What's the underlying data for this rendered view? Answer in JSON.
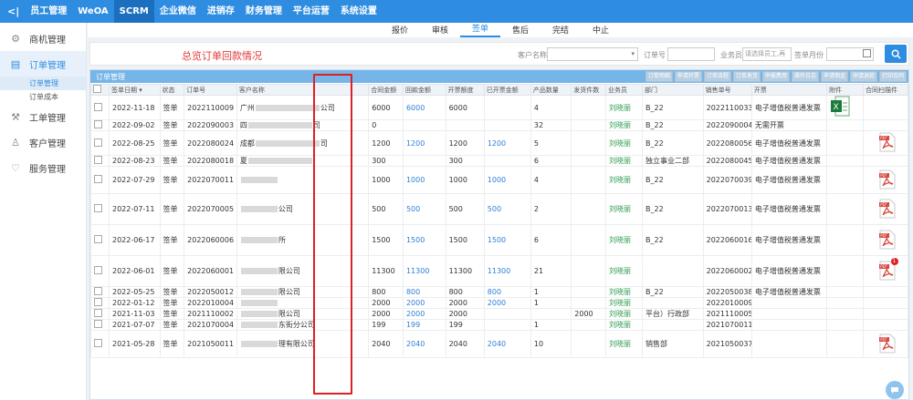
{
  "topbar": {
    "back": "<|",
    "nav": [
      "员工管理",
      "WeOA",
      "SCRM",
      "企业微信",
      "进销存",
      "财务管理",
      "平台运营",
      "系统设置"
    ],
    "active": "SCRM"
  },
  "sidebar": {
    "items": [
      {
        "label": "商机管理",
        "icon": "gear-icon"
      },
      {
        "label": "订单管理",
        "icon": "order-icon",
        "active": true,
        "subs": [
          {
            "label": "订单管理",
            "active": true
          },
          {
            "label": "订单成本",
            "active": false
          }
        ]
      },
      {
        "label": "工单管理",
        "icon": "ticket-icon"
      },
      {
        "label": "客户管理",
        "icon": "user-icon"
      },
      {
        "label": "服务管理",
        "icon": "heart-icon"
      }
    ]
  },
  "tabs": [
    "报价",
    "审核",
    "签单",
    "售后",
    "完结",
    "中止"
  ],
  "tabs_active": "签单",
  "annotation": "总览订单回款情况",
  "filters": {
    "customer_label": "客户名称",
    "order_label": "订单号",
    "staff_label": "业务员",
    "staff_placeholder": "请选择员工,再",
    "month_label": "签单月份"
  },
  "panel": {
    "title": "订单管理",
    "buttons": [
      "订单明细",
      "申请开票",
      "订单流程",
      "订单发货",
      "申报费用",
      "操作日志",
      "申请佣金",
      "申请退款",
      "打印合同"
    ]
  },
  "table": {
    "headers": [
      "",
      "签单日期 ▾",
      "状态",
      "订单号",
      "客户名称",
      "合同金额",
      "回款金额",
      "开票额度",
      "已开票金额",
      "产品数量",
      "发货件数",
      "业务员",
      "部门",
      "销售单号",
      "开票",
      "附件",
      "合同扫描件"
    ],
    "rows": [
      {
        "date": "2022-11-18",
        "status": "签单",
        "order": "2022110009",
        "cust_pre": "广州",
        "cust_post": "公司",
        "contract": "6000",
        "paid": "6000",
        "quota": "6000",
        "invoiced": "",
        "qty": "4",
        "ship": "",
        "sales": "刘晓丽",
        "dept": "B_22",
        "salesno": "2022110033",
        "invoice": "电子增值税普通发票",
        "att": "xls",
        "scan": "",
        "h": 27
      },
      {
        "date": "2022-09-02",
        "status": "签单",
        "order": "2022090003",
        "cust_pre": "四",
        "cust_post": "司",
        "contract": "0",
        "paid": "",
        "quota": "",
        "invoiced": "",
        "qty": "32",
        "ship": "",
        "sales": "刘晓丽",
        "dept": "B_22",
        "salesno": "2022090004",
        "invoice": "无需开票",
        "att": "",
        "scan": "",
        "h": 11
      },
      {
        "date": "2022-08-25",
        "status": "签单",
        "order": "2022080024",
        "cust_pre": "成都",
        "cust_post": "司",
        "contract": "1200",
        "paid": "1200",
        "quota": "1200",
        "invoiced": "1200",
        "qty": "5",
        "ship": "",
        "sales": "刘晓丽",
        "dept": "B_22",
        "salesno": "2022080056",
        "invoice": "电子增值税普通发票",
        "att": "",
        "scan": "pdf",
        "h": 27
      },
      {
        "date": "2022-08-23",
        "status": "签单",
        "order": "2022080018",
        "cust_pre": "夏",
        "cust_post": "",
        "contract": "300",
        "paid": "",
        "quota": "300",
        "invoiced": "",
        "qty": "6",
        "ship": "",
        "sales": "刘晓丽",
        "dept": "独立事业二部",
        "salesno": "2022080045",
        "invoice": "电子增值税普通发票",
        "att": "",
        "scan": "",
        "h": 11
      },
      {
        "date": "2022-07-29",
        "status": "签单",
        "order": "2022070011",
        "cust_pre": "",
        "cust_post": "",
        "contract": "1000",
        "paid": "1000",
        "quota": "1000",
        "invoiced": "1000",
        "qty": "4",
        "ship": "",
        "sales": "刘晓丽",
        "dept": "B_22",
        "salesno": "2022070039",
        "invoice": "电子增值税普通发票",
        "att": "",
        "scan": "pdf",
        "h": 30
      },
      {
        "date": "2022-07-11",
        "status": "签单",
        "order": "2022070005",
        "cust_pre": "",
        "cust_post": "公司",
        "contract": "500",
        "paid": "500",
        "quota": "500",
        "invoiced": "500",
        "qty": "2",
        "ship": "",
        "sales": "刘晓丽",
        "dept": "B_22",
        "salesno": "2022070013",
        "invoice": "电子增值税普通发票",
        "att": "",
        "scan": "pdf",
        "h": 34
      },
      {
        "date": "2022-06-17",
        "status": "签单",
        "order": "2022060006",
        "cust_pre": "",
        "cust_post": "所",
        "contract": "1500",
        "paid": "1500",
        "quota": "1500",
        "invoiced": "1500",
        "qty": "6",
        "ship": "",
        "sales": "刘晓丽",
        "dept": "B_22",
        "salesno": "2022060016",
        "invoice": "电子增值税普通发票",
        "att": "",
        "scan": "pdf",
        "h": 34
      },
      {
        "date": "2022-06-01",
        "status": "签单",
        "order": "2022060001",
        "cust_pre": "",
        "cust_post": "限公司",
        "contract": "11300",
        "paid": "11300",
        "quota": "11300",
        "invoiced": "11300",
        "qty": "21",
        "ship": "",
        "sales": "刘晓丽",
        "dept": "",
        "salesno": "2022060002",
        "invoice": "电子增值税普通发票",
        "att": "",
        "scan": "pdf1",
        "h": 34
      },
      {
        "date": "2022-05-25",
        "status": "签单",
        "order": "2022050012",
        "cust_pre": "",
        "cust_post": "限公司",
        "contract": "800",
        "paid": "800",
        "quota": "800",
        "invoiced": "800",
        "qty": "1",
        "ship": "",
        "sales": "刘晓丽",
        "dept": "B_22",
        "salesno": "2022050038",
        "invoice": "电子增值税普通发票",
        "att": "",
        "scan": "",
        "h": 11
      },
      {
        "date": "2022-01-12",
        "status": "签单",
        "order": "2022010004",
        "cust_pre": "",
        "cust_post": "",
        "contract": "2000",
        "paid": "2000",
        "quota": "2000",
        "invoiced": "2000",
        "qty": "1",
        "ship": "",
        "sales": "刘晓丽",
        "dept": "",
        "salesno": "2022010009",
        "invoice": "",
        "att": "",
        "scan": "",
        "h": 11
      },
      {
        "date": "2021-11-03",
        "status": "签单",
        "order": "2021110002",
        "cust_pre": "",
        "cust_post": "限公司",
        "contract": "2000",
        "paid": "2000",
        "quota": "2000",
        "invoiced": "",
        "qty": "",
        "ship": "2000",
        "sales": "刘晓丽",
        "dept": "平台）行政部",
        "salesno": "2021110005",
        "invoice": "",
        "att": "",
        "scan": "",
        "h": 11
      },
      {
        "date": "2021-07-07",
        "status": "签单",
        "order": "2021070004",
        "cust_pre": "",
        "cust_post": "东街分公司",
        "contract": "199",
        "paid": "199",
        "quota": "199",
        "invoiced": "",
        "qty": "1",
        "ship": "",
        "sales": "刘晓丽",
        "dept": "",
        "salesno": "2021070011",
        "invoice": "",
        "att": "",
        "scan": "",
        "h": 11
      },
      {
        "date": "2021-05-28",
        "status": "签单",
        "order": "2021050011",
        "cust_pre": "",
        "cust_post": "理有限公司",
        "contract": "2040",
        "paid": "2040",
        "quota": "2040",
        "invoiced": "2040",
        "qty": "10",
        "ship": "",
        "sales": "刘晓丽",
        "dept": "销售部",
        "salesno": "2021050037",
        "invoice": "",
        "att": "",
        "scan": "pdf",
        "h": 30
      }
    ]
  }
}
